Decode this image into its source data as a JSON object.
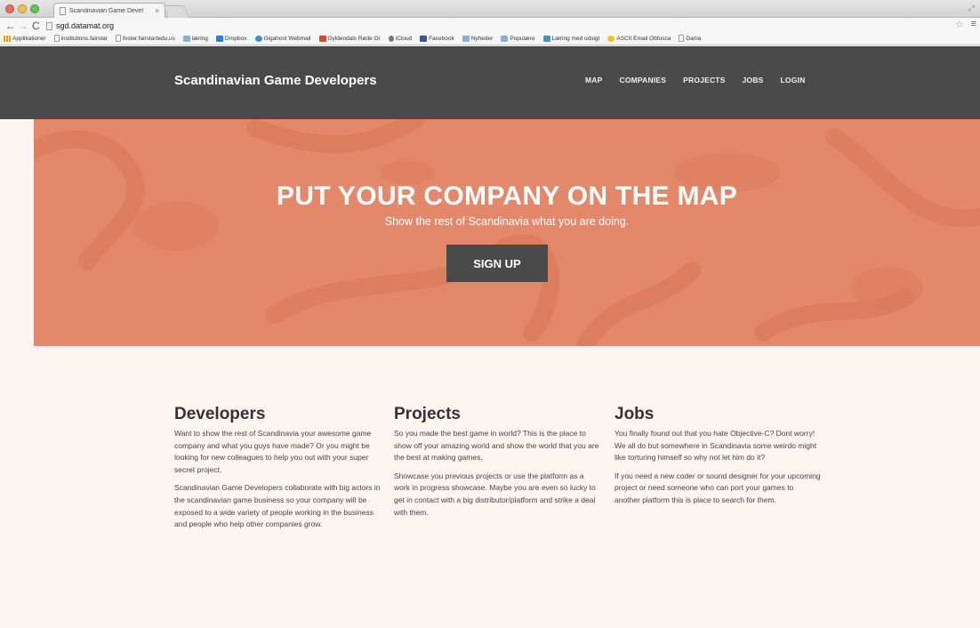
{
  "browser": {
    "tab_title": "Scandinavian Game Devel",
    "tab_close": "×",
    "url": "sgd.datamat.org",
    "bookmarks": [
      {
        "label": "Applikationer",
        "icon": "apps-icon"
      },
      {
        "label": "institutions.fairstar",
        "icon": "document-icon"
      },
      {
        "label": "foster.fairstartedu.us",
        "icon": "document-icon"
      },
      {
        "label": "læring",
        "icon": "folder-icon"
      },
      {
        "label": "Dropbox",
        "icon": "dropbox-icon"
      },
      {
        "label": "Gigahost Webmail",
        "icon": "gigahost-icon"
      },
      {
        "label": "Gyldendals Røde Or",
        "icon": "gyldendal-icon"
      },
      {
        "label": "iCloud",
        "icon": "apple-icon"
      },
      {
        "label": "Facebook",
        "icon": "facebook-icon"
      },
      {
        "label": "Nyheder",
        "icon": "folder-icon"
      },
      {
        "label": "Populære",
        "icon": "folder-icon"
      },
      {
        "label": "Læring med udsigt",
        "icon": "laering-icon"
      },
      {
        "label": "ASCII Email Obfusca",
        "icon": "ascii-icon"
      },
      {
        "label": "Dania",
        "icon": "document-icon"
      }
    ]
  },
  "header": {
    "brand": "Scandinavian Game Developers",
    "nav": [
      "MAP",
      "COMPANIES",
      "PROJECTS",
      "JOBS",
      "LOGIN"
    ]
  },
  "hero": {
    "title": "PUT YOUR COMPANY ON THE MAP",
    "subtitle": "Show the rest of Scandinavia what you are doing.",
    "button": "SIGN UP",
    "color": "#e3886a"
  },
  "columns": {
    "developers": {
      "heading": "Developers",
      "p1": "Want to show the rest of Scandinavia your awesome game company and what you guys have made? Or you might be looking for new colleagues to help you out with your super secret project.",
      "p2": "Scandinavian Game Developers collaborate with big actors in the scandinavian game business so your company will be exposed to a wide variety of people working in the business and people who help other companies grow."
    },
    "projects": {
      "heading": "Projects",
      "p1": "So you made the best game in world? This is the place to show off your amazing world and show the world that you are the best at making games.",
      "p2": "Showcase you previous projects or use the platform as a work in progress showcase. Maybe you are even so lucky to get in contact with a big distributor/platform and strike a deal with them."
    },
    "jobs": {
      "heading": "Jobs",
      "p1": "You finally found out that you hate Objective-C? Dont worry! We all do but somewhere in Scandinavia some weirdo might like torturing himself so why not let him do it?",
      "p2": "If you need a new coder or sound designer for your upcoming project or need someone who can port your games to another platform this is place to search for them."
    }
  }
}
